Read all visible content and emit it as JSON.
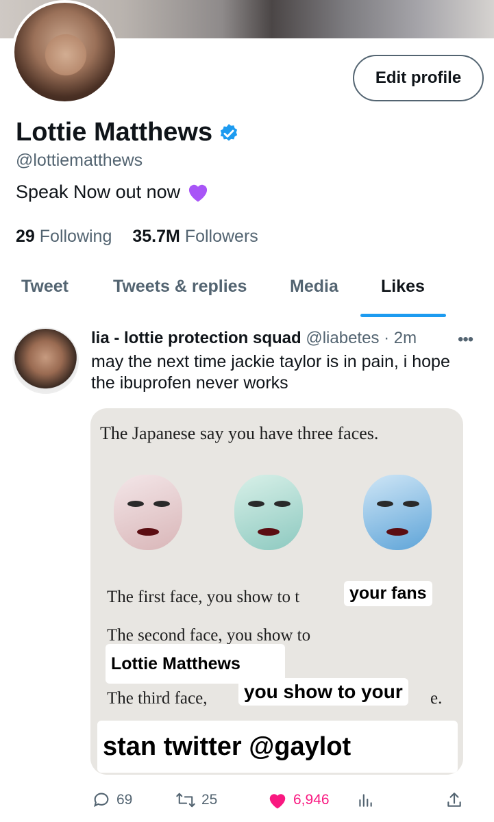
{
  "profile": {
    "name": "Lottie Matthews",
    "handle": "@lottiematthews",
    "bio": "Speak Now out now",
    "bio_emoji": "purple-heart-icon",
    "following_count": "29",
    "following_label": "Following",
    "followers_count": "35.7M",
    "followers_label": "Followers",
    "edit_button": "Edit profile"
  },
  "tabs": [
    {
      "label": "Tweet"
    },
    {
      "label": "Tweets & replies"
    },
    {
      "label": "Media"
    },
    {
      "label": "Likes",
      "active": true
    }
  ],
  "tweet": {
    "author": "lia - lottie protection squad",
    "username": "@liabetes",
    "time": "· 2m",
    "text": "may the next time jackie taylor is in pain, i hope the ibuprofen never works",
    "media": {
      "title": "The Japanese say you have three faces.",
      "line1": "The first face, you show to t",
      "line2": "The second face, you show to",
      "line3": "The third face,",
      "line3_end": "e.",
      "overlay1": "your fans",
      "overlay2": "Lottie Matthews",
      "overlay3": "you show to your",
      "overlay4": "stan twitter @gaylot"
    },
    "replies": "69",
    "retweets": "25",
    "likes": "6,946"
  },
  "colors": {
    "accent": "#1d9bf0",
    "like": "#f91880",
    "secondary_text": "#536471"
  }
}
